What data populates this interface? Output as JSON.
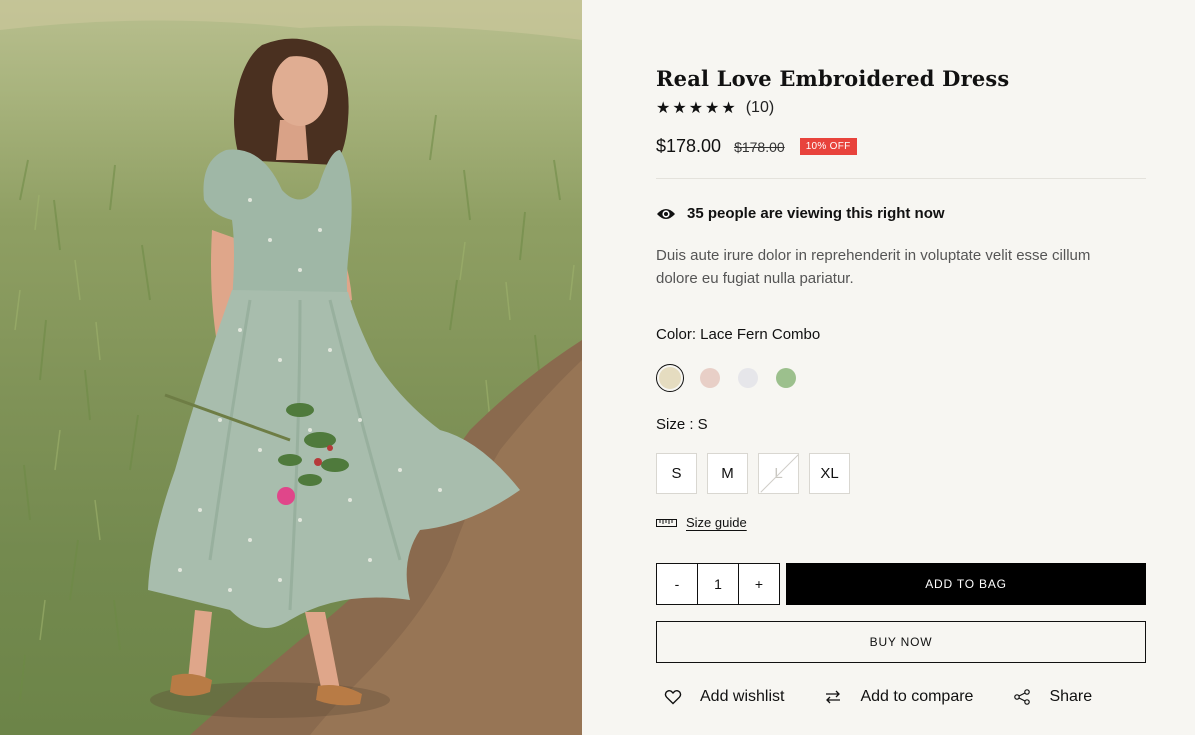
{
  "product": {
    "title": "Real Love Embroidered Dress",
    "stars": "★★★★★",
    "review_count": "(10)",
    "price": "$178.00",
    "old_price": "$178.00",
    "discount_badge": "10% OFF",
    "viewing_text": "35 people are viewing this right now",
    "description": "Duis aute irure dolor in reprehenderit in voluptate velit esse cillum dolore eu fugiat nulla pariatur."
  },
  "color": {
    "label": "Color: Lace Fern Combo",
    "swatches": [
      {
        "name": "lace-fern-combo",
        "hex": "#e5dcc0",
        "selected": true
      },
      {
        "name": "blush",
        "hex": "#e8cfc7",
        "selected": false
      },
      {
        "name": "light-grey",
        "hex": "#e6e6ea",
        "selected": false
      },
      {
        "name": "sage-green",
        "hex": "#9cc08d",
        "selected": false
      }
    ]
  },
  "size": {
    "label": "Size : S",
    "options": [
      {
        "label": "S",
        "available": true
      },
      {
        "label": "M",
        "available": true
      },
      {
        "label": "L",
        "available": false
      },
      {
        "label": "XL",
        "available": true
      }
    ],
    "guide_label": "Size guide"
  },
  "cart": {
    "minus": "-",
    "quantity": "1",
    "plus": "+",
    "add_to_bag": "ADD TO BAG",
    "buy_now": "BUY NOW"
  },
  "actions": {
    "wishlist": "Add wishlist",
    "compare": "Add to compare",
    "share": "Share"
  },
  "colors": {
    "panel_bg": "#f7f6f2",
    "discount_bg": "#e8433c",
    "primary": "#000000"
  }
}
